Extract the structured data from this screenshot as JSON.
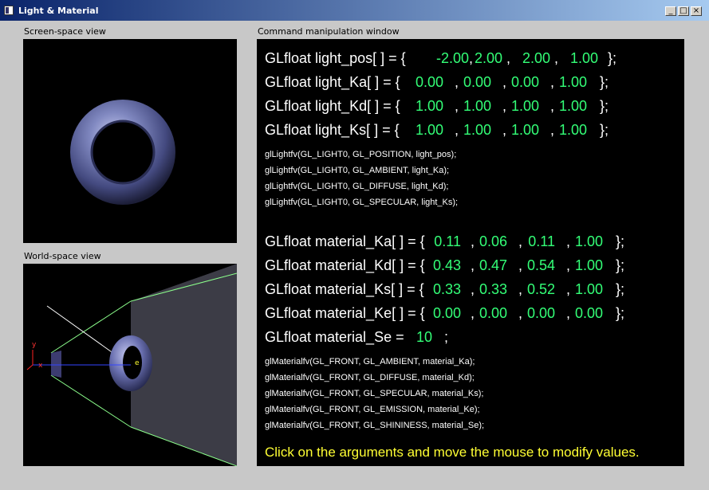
{
  "window": {
    "title": "Light & Material",
    "minimize_glyph": "_",
    "maximize_glyph": "□",
    "close_glyph": "×"
  },
  "screen_view": {
    "label": "Screen-space view"
  },
  "world_view": {
    "label": "World-space view",
    "axis_y": "y",
    "axis_x": "x",
    "axis_z": "e"
  },
  "command": {
    "label": "Command manipulation window",
    "light_pos": {
      "prefix": "GLfloat light_pos[ ] = {",
      "values": [
        "-2.00",
        "2.00",
        "2.00",
        "1.00"
      ],
      "end": "};"
    },
    "light_ka": {
      "prefix": "GLfloat light_Ka[ ] = {",
      "values": [
        "0.00",
        "0.00",
        "0.00",
        "1.00"
      ],
      "end": "};"
    },
    "light_kd": {
      "prefix": "GLfloat light_Kd[ ] = {",
      "values": [
        "1.00",
        "1.00",
        "1.00",
        "1.00"
      ],
      "end": "};"
    },
    "light_ks": {
      "prefix": "GLfloat light_Ks[ ] = {",
      "values": [
        "1.00",
        "1.00",
        "1.00",
        "1.00"
      ],
      "end": "};"
    },
    "light_code": [
      "glLightfv(GL_LIGHT0, GL_POSITION, light_pos);",
      "glLightfv(GL_LIGHT0, GL_AMBIENT, light_Ka);",
      "glLightfv(GL_LIGHT0, GL_DIFFUSE, light_Kd);",
      "glLightfv(GL_LIGHT0, GL_SPECULAR, light_Ks);"
    ],
    "material_ka": {
      "prefix": "GLfloat material_Ka[ ] = {",
      "values": [
        "0.11",
        "0.06",
        "0.11",
        "1.00"
      ],
      "end": "};"
    },
    "material_kd": {
      "prefix": "GLfloat material_Kd[ ] = {",
      "values": [
        "0.43",
        "0.47",
        "0.54",
        "1.00"
      ],
      "end": "};"
    },
    "material_ks": {
      "prefix": "GLfloat material_Ks[ ] = {",
      "values": [
        "0.33",
        "0.33",
        "0.52",
        "1.00"
      ],
      "end": "};"
    },
    "material_ke": {
      "prefix": "GLfloat material_Ke[ ] = {",
      "values": [
        "0.00",
        "0.00",
        "0.00",
        "0.00"
      ],
      "end": "};"
    },
    "material_se": {
      "prefix": "GLfloat material_Se =",
      "value": "10",
      "end": ";"
    },
    "material_code": [
      "glMaterialfv(GL_FRONT, GL_AMBIENT, material_Ka);",
      "glMaterialfv(GL_FRONT, GL_DIFFUSE, material_Kd);",
      "glMaterialfv(GL_FRONT, GL_SPECULAR, material_Ks);",
      "glMaterialfv(GL_FRONT, GL_EMISSION, material_Ke);",
      "glMaterialfv(GL_FRONT, GL_SHININESS, material_Se);"
    ],
    "footer": "Click on the arguments and move the mouse to modify values."
  },
  "colors": {
    "value_green": "#33ff77",
    "footer_yellow": "#ffff33",
    "torus_blue": "#6a70b0"
  }
}
